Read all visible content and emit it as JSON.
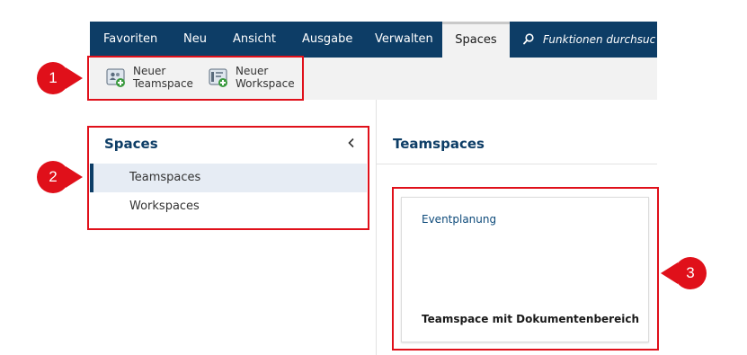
{
  "menu": {
    "items": [
      {
        "label": "Favoriten"
      },
      {
        "label": "Neu"
      },
      {
        "label": "Ansicht"
      },
      {
        "label": "Ausgabe"
      },
      {
        "label": "Verwalten"
      },
      {
        "label": "Spaces",
        "active": true
      }
    ],
    "search_text": "Funktionen durchsuc",
    "search_icon": "search-icon"
  },
  "ribbon": {
    "new_teamspace": {
      "line1": "Neuer",
      "line2": "Teamspace",
      "icon": "new-teamspace-icon"
    },
    "new_workspace": {
      "line1": "Neuer",
      "line2": "Workspace",
      "icon": "new-workspace-icon"
    }
  },
  "left_pane": {
    "title": "Spaces",
    "collapse_icon": "chevron-left-icon",
    "items": [
      {
        "label": "Teamspaces",
        "selected": true
      },
      {
        "label": "Workspaces",
        "selected": false
      }
    ]
  },
  "right_pane": {
    "title": "Teamspaces",
    "card": {
      "title": "Eventplanung",
      "description": "Teamspace mit Dokumentenbereich"
    }
  },
  "callouts": [
    {
      "number": "1"
    },
    {
      "number": "2"
    },
    {
      "number": "3"
    }
  ],
  "colors": {
    "menubar": "#0d3d66",
    "accent": "#0d3d66",
    "callout": "#e0101a",
    "selected_bg": "#e6ecf4"
  }
}
